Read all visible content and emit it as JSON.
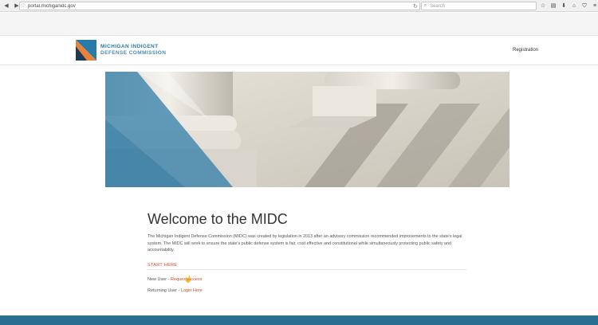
{
  "browser": {
    "back_icon": "back-arrow-icon",
    "forward_icon": "forward-arrow-icon",
    "url": "portal.michiganidc.gov",
    "search_placeholder": "Search",
    "toolbar_icons": [
      "star-icon",
      "clipboard-icon",
      "download-icon",
      "home-icon",
      "shield-icon",
      "menu-icon"
    ]
  },
  "header": {
    "logo_line1": "MICHIGAN INDIGENT",
    "logo_line2": "DEFENSE COMMISSION",
    "registration_label": "Registration"
  },
  "colors": {
    "brand_blue": "#2a7aa8",
    "accent_orange": "#c44f2a",
    "footer_blue": "#2a6f92"
  },
  "main": {
    "title": "Welcome to the MIDC",
    "intro": "The Michigan Indigent Defense Commission (MIDC) was created by legislation in 2013 after an advisory commission recommended improvements to the state's legal system. The MIDC will work to ensure the state's public defense system is fair, cost effective and constitutional while simultaneously protecting public safety and accountability.",
    "start_here": "START HERE",
    "new_user_label": "New User - ",
    "new_user_link": "Request Access",
    "returning_user_label": "Returning User - ",
    "returning_user_link": "Login Here"
  }
}
